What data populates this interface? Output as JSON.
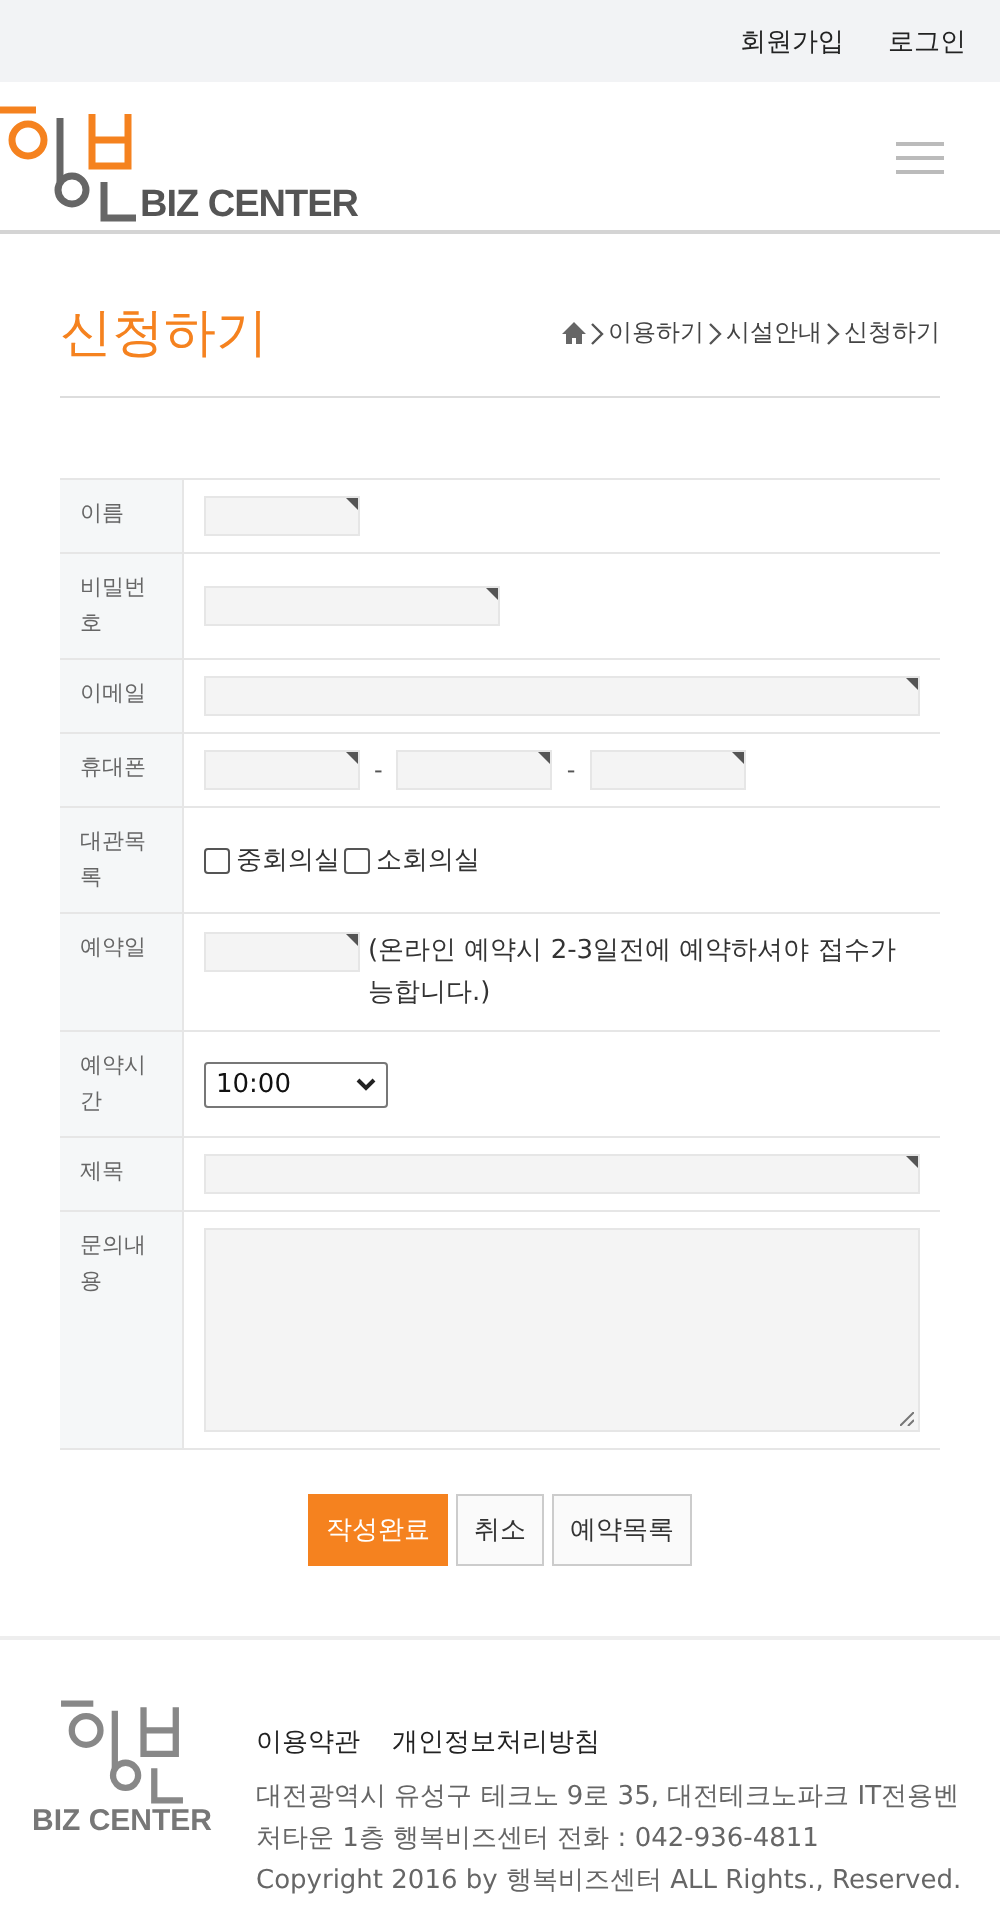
{
  "top_links": [
    "회원가입",
    "로그인"
  ],
  "logo": {
    "text": "BIZ CENTER"
  },
  "page_title": "신청하기",
  "breadcrumb": [
    "이용하기",
    "시설안내",
    "신청하기"
  ],
  "form_rows": [
    {
      "label": "이름",
      "kind": "short_text"
    },
    {
      "label": "비밀번호",
      "kind": "medium_text"
    },
    {
      "label": "이메일",
      "kind": "wide_text"
    },
    {
      "label": "휴대폰",
      "kind": "phone",
      "separators": [
        "-",
        "-"
      ]
    },
    {
      "label": "대관목록",
      "kind": "checkboxes",
      "options": [
        {
          "label": "중회의실",
          "checked": false
        },
        {
          "label": "소회의실",
          "checked": false
        }
      ]
    },
    {
      "label": "예약일",
      "kind": "date",
      "note": "(온라인 예약시 2-3일전에 예약하셔야 접수가 능합니다.)"
    },
    {
      "label": "예약시간",
      "kind": "select",
      "value": "10:00"
    },
    {
      "label": "제목",
      "kind": "wide_text"
    },
    {
      "label": "문의내용",
      "kind": "textarea"
    }
  ],
  "buttons": [
    {
      "label": "작성완료",
      "kind": "primary"
    },
    {
      "label": "취소",
      "kind": "plain"
    },
    {
      "label": "예약목록",
      "kind": "plain"
    }
  ],
  "footer": {
    "logo_text": "BIZ CENTER",
    "links": [
      "이용약관",
      "개인정보처리방침"
    ],
    "address": "대전광역시 유성구 테크노 9로 35, 대전테크노파크 IT전용벤처타운 1층 행복비즈센터 전화 : 042-936-4811",
    "copyright": "Copyright 2016 by 행복비즈센터 ALL Rights., Reserved."
  }
}
